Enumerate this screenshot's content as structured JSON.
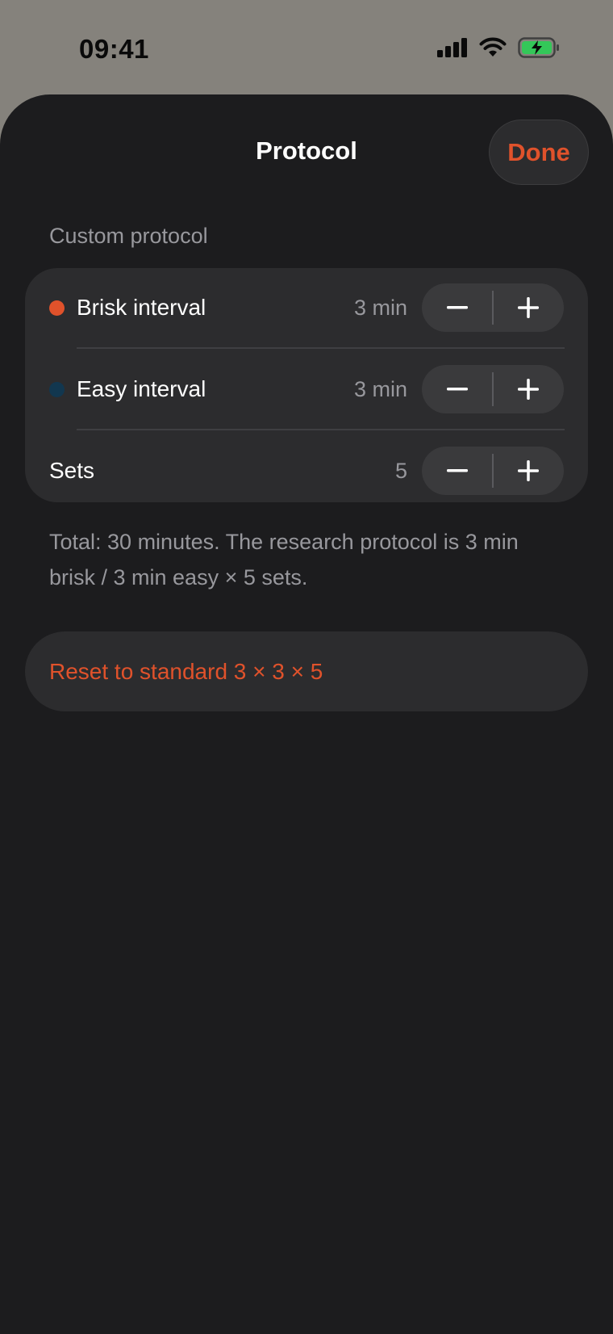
{
  "status_bar": {
    "time": "09:41",
    "icons": [
      "cellular-signal-icon",
      "wifi-icon",
      "battery-charging-icon"
    ]
  },
  "sheet": {
    "title": "Protocol",
    "done_label": "Done"
  },
  "section": {
    "label": "Custom protocol"
  },
  "rows": [
    {
      "label": "Brisk interval",
      "value": "3 min",
      "dot_color": "#e0522b"
    },
    {
      "label": "Easy interval",
      "value": "3 min",
      "dot_color": "#12374f"
    },
    {
      "label": "Sets",
      "value": "5"
    }
  ],
  "footnote": "Total: 30 minutes. The research protocol is 3 min brisk / 3 min easy × 5 sets.",
  "reset_label": "Reset to standard 3 × 3 × 5",
  "colors": {
    "accent": "#e0522b",
    "background": "#1c1c1e",
    "card": "#2c2c2e",
    "secondary_text": "#98989d",
    "battery_green": "#34c759"
  }
}
